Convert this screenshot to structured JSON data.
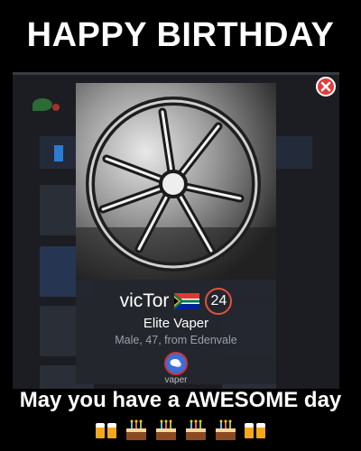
{
  "banner": {
    "title": "HAPPY BIRTHDAY"
  },
  "profile": {
    "username": "vicTor",
    "flag_icon": "south-africa-flag-icon",
    "age": "24",
    "rank": "Elite Vaper",
    "details": "Male, 47, from Edenvale",
    "chat_icon": "chat-bubble-icon",
    "label_below": "vaper"
  },
  "close_icon": "close-icon",
  "message": "May you have a AWESOME day",
  "emojis": [
    "beer-mugs-icon",
    "cake-icon",
    "cake-icon",
    "cake-icon",
    "cake-icon",
    "beer-mugs-icon"
  ],
  "colors": {
    "close": "#e23b3b",
    "age_ring": "#e0533a",
    "chat": "#3b6fd8",
    "details": "#9aa0a8"
  }
}
